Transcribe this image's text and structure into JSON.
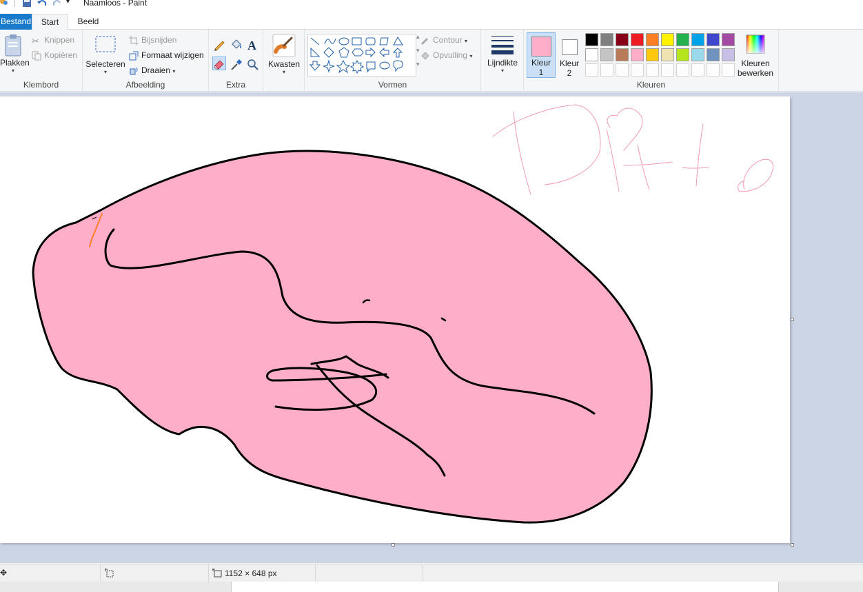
{
  "window": {
    "title": "Naamloos - Paint"
  },
  "tabs": [
    "Bestand",
    "Start",
    "Beeld"
  ],
  "clipboard": {
    "paste": "Plakken",
    "cut": "Knippen",
    "copy": "Kopiëren",
    "group": "Klembord"
  },
  "image": {
    "select": "Selecteren",
    "crop": "Bijsnijden",
    "resize": "Formaat wijzigen",
    "rotate": "Draaien",
    "group": "Afbeelding"
  },
  "tools": {
    "group": "Extra"
  },
  "brushes": {
    "label": "Kwasten"
  },
  "shapes": {
    "outline": "Contour",
    "fill": "Opvulling",
    "group": "Vormen"
  },
  "size": {
    "label": "Lijndikte"
  },
  "colors": {
    "color1_line1": "Kleur",
    "color1_line2": "1",
    "color2_line1": "Kleur",
    "color2_line2": "2",
    "edit_line1": "Kleuren",
    "edit_line2": "bewerken",
    "group": "Kleuren",
    "color1_value": "#ffaec9",
    "color2_value": "#ffffff",
    "palette_row1": [
      "#000000",
      "#7f7f7f",
      "#880015",
      "#ed1c24",
      "#ff7f27",
      "#fff200",
      "#22b14c",
      "#00a2e8",
      "#3f48cc",
      "#a349a4"
    ],
    "palette_row2": [
      "#ffffff",
      "#c3c3c3",
      "#b97a57",
      "#ffaec9",
      "#ffc90e",
      "#efe4b0",
      "#b5e61d",
      "#99d9ea",
      "#7092be",
      "#c8bfe7"
    ]
  },
  "canvas": {
    "handwritten_text": "Ditto"
  },
  "status": {
    "dimensions": "1152 × 648 px"
  }
}
